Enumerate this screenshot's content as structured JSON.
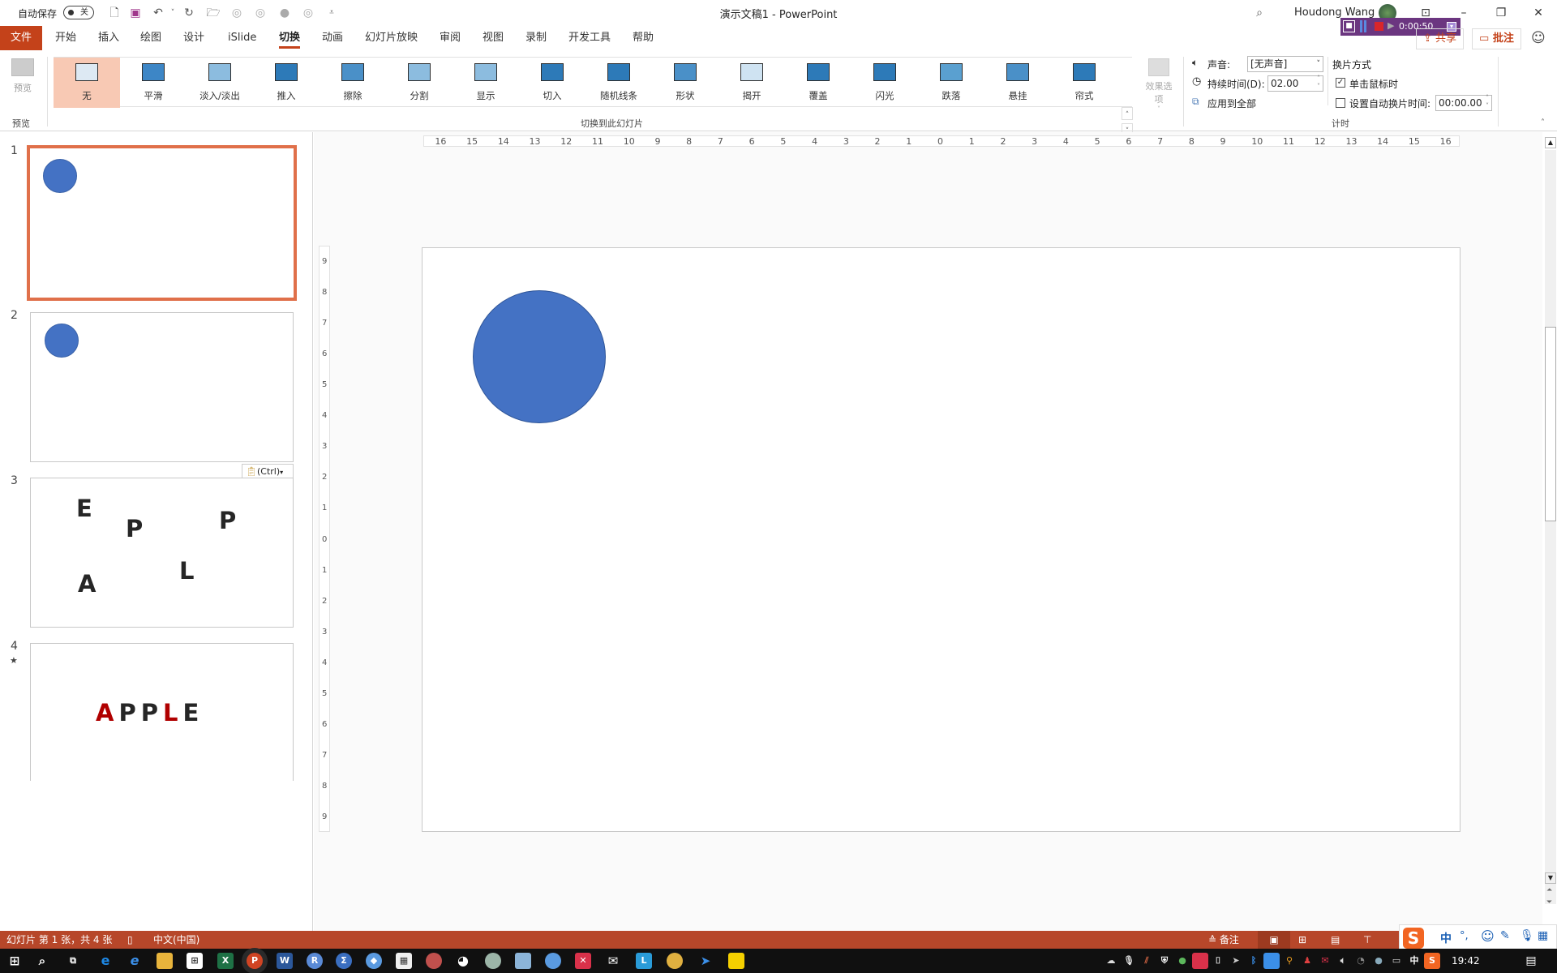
{
  "titlebar": {
    "autosave_label": "自动保存",
    "autosave_state": "关",
    "doc_title": "演示文稿1  -  PowerPoint",
    "user_name": "Houdong Wang",
    "quick_access": [
      "new-file-icon",
      "save-icon",
      "undo-icon",
      "redo-icon",
      "open-folder-icon",
      "shape-union-icon",
      "shape-intersect-icon",
      "shape-combine-icon",
      "shape-fragment-icon",
      "customize-qat-icon"
    ]
  },
  "recorder": {
    "time": "0:00:50"
  },
  "menu": {
    "tabs": [
      "文件",
      "开始",
      "插入",
      "绘图",
      "设计",
      "iSlide",
      "切换",
      "动画",
      "幻灯片放映",
      "审阅",
      "视图",
      "录制",
      "开发工具",
      "帮助"
    ],
    "active": "切换",
    "share_label": "共享",
    "comment_label": "批注"
  },
  "ribbon": {
    "preview_label": "预览",
    "preview_group": "预览",
    "transitions_group": "切换到此幻灯片",
    "transitions": [
      "无",
      "平滑",
      "淡入/淡出",
      "推入",
      "擦除",
      "分割",
      "显示",
      "切入",
      "随机线条",
      "形状",
      "揭开",
      "覆盖",
      "闪光",
      "跌落",
      "悬挂",
      "帘式"
    ],
    "selected_transition": "无",
    "effect_options_label": "效果选项",
    "sound_label": "声音:",
    "sound_value": "[无声音]",
    "duration_label": "持续时间(D):",
    "duration_value": "02.00",
    "apply_all_label": "应用到全部",
    "advance_label": "换片方式",
    "on_click_label": "单击鼠标时",
    "on_click_checked": true,
    "after_label": "设置自动换片时间:",
    "after_checked": false,
    "after_value": "00:00.00",
    "timing_group": "计时"
  },
  "slides": [
    {
      "num": "1",
      "content": "circle",
      "selected": true
    },
    {
      "num": "2",
      "content": "circle"
    },
    {
      "num": "3",
      "letters": [
        "E",
        "P",
        "P",
        "A",
        "L"
      ]
    },
    {
      "num": "4",
      "star": "★",
      "word": [
        "A",
        "P",
        "P",
        "L",
        "E"
      ],
      "red_letters": [
        "A",
        "L"
      ]
    }
  ],
  "paste_options": "(Ctrl)",
  "ruler": {
    "h_ticks": [
      "16",
      "15",
      "14",
      "13",
      "12",
      "11",
      "10",
      "9",
      "8",
      "7",
      "6",
      "5",
      "4",
      "3",
      "2",
      "1",
      "0",
      "1",
      "2",
      "3",
      "4",
      "5",
      "6",
      "7",
      "8",
      "9",
      "10",
      "11",
      "12",
      "13",
      "14",
      "15",
      "16"
    ],
    "v_ticks": [
      "9",
      "8",
      "7",
      "6",
      "5",
      "4",
      "3",
      "2",
      "1",
      "0",
      "1",
      "2",
      "3",
      "4",
      "5",
      "6",
      "7",
      "8",
      "9"
    ]
  },
  "status": {
    "slide_info": "幻灯片 第 1 张，共 4 张",
    "language": "中文(中国)",
    "notes_label": "备注"
  },
  "ime": {
    "mode": "中",
    "punct": "°,"
  },
  "taskbar": {
    "clock": "19:42",
    "tray_lang": "中"
  },
  "colors": {
    "accent": "#c4421a",
    "shape_fill": "#4472c4",
    "selected_transition_bg": "#f8c9b4",
    "thumb_selected": "#e0704a",
    "letter_red": "#b00000"
  }
}
